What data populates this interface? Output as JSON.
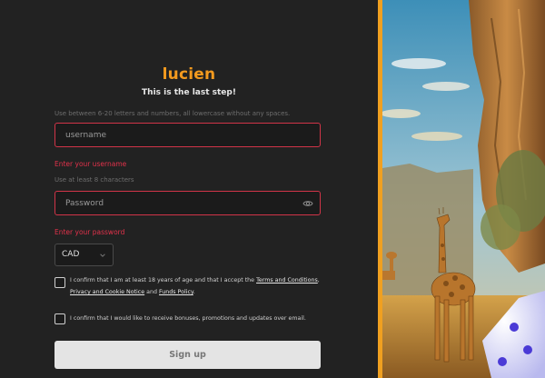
{
  "brand": {
    "name": "lucien"
  },
  "form": {
    "subtitle": "This is the last step!",
    "username_hint": "Use between 6-20 letters and numbers, all lowercase without any spaces.",
    "username_placeholder": "username",
    "username_error": "Enter your username",
    "password_hint": "Use at least 8 characters",
    "password_placeholder": "Password",
    "password_error": "Enter your password",
    "currency": {
      "selected": "CAD"
    },
    "consent_age": {
      "prefix": "I confirm that I am at least 18 years of age and that I accept the ",
      "terms_link": "Terms and Conditions",
      "sep1": ", ",
      "privacy_link": "Privacy and Cookie Notice",
      "sep2": " and ",
      "funds_link": "Funds Policy",
      "suffix": "."
    },
    "consent_marketing": "I confirm that I would like to receive bonuses, promotions and updates over email.",
    "submit_label": "Sign up"
  },
  "colors": {
    "accent": "#f39a1e",
    "error": "#e3324b",
    "panel_bg": "#222222",
    "divider": "#f0a020"
  },
  "icons": {
    "password_toggle": "eye-icon",
    "select_arrow": "chevron-down-icon"
  }
}
